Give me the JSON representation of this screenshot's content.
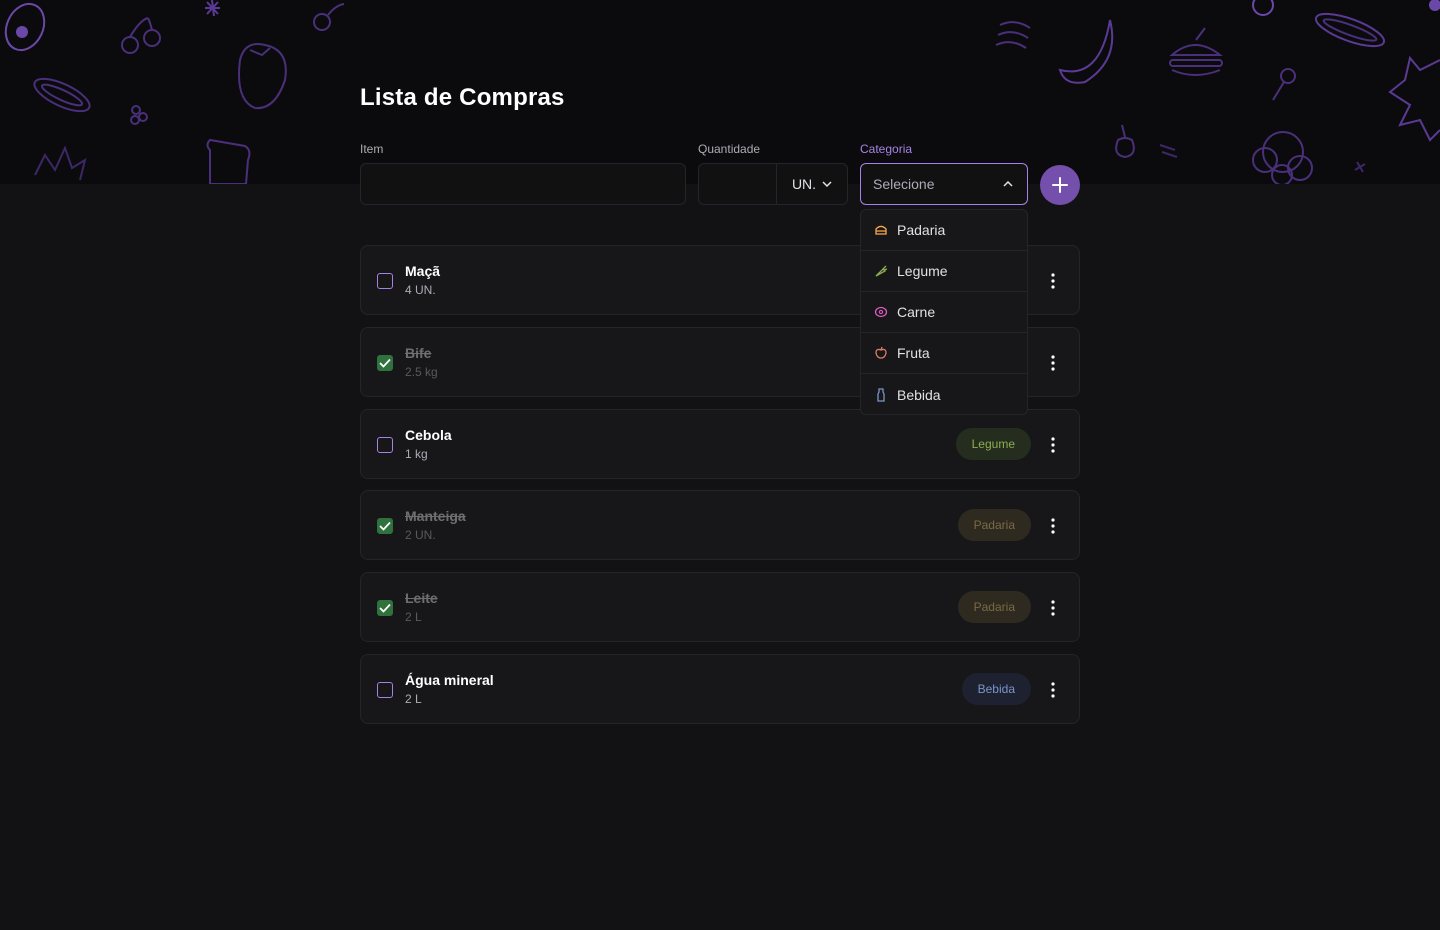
{
  "page": {
    "title": "Lista de Compras"
  },
  "form": {
    "item_label": "Item",
    "item_value": "",
    "quantity_label": "Quantidade",
    "quantity_value": "",
    "unit_value": "UN.",
    "category_label": "Categoria",
    "category_placeholder": "Selecione",
    "add_icon": "plus-icon"
  },
  "dropdown": {
    "open": true,
    "options": [
      {
        "label": "Padaria",
        "icon": "bread-icon",
        "color": "#fba94c"
      },
      {
        "label": "Legume",
        "icon": "carrot-icon",
        "color": "#8cad51"
      },
      {
        "label": "Carne",
        "icon": "beef-icon",
        "color": "#db5bbf"
      },
      {
        "label": "Fruta",
        "icon": "apple-icon",
        "color": "#e07b67"
      },
      {
        "label": "Bebida",
        "icon": "milk-icon",
        "color": "#7b94cb"
      }
    ]
  },
  "items": [
    {
      "name": "Maçã",
      "quantity": "4 UN.",
      "checked": false,
      "category": ""
    },
    {
      "name": "Bife",
      "quantity": "2.5 kg",
      "checked": true,
      "category": ""
    },
    {
      "name": "Cebola",
      "quantity": "1 kg",
      "checked": false,
      "category": "Legume"
    },
    {
      "name": "Manteiga",
      "quantity": "2 UN.",
      "checked": true,
      "category": "Padaria"
    },
    {
      "name": "Leite",
      "quantity": "2 L",
      "checked": true,
      "category": "Padaria"
    },
    {
      "name": "Água mineral",
      "quantity": "2 L",
      "checked": false,
      "category": "Bebida"
    }
  ],
  "colors": {
    "accent": "#a881e6",
    "accent_button": "#7450ac",
    "checked": "#2f723d",
    "tag_legume_bg": "#252d1e",
    "tag_legume_fg": "#8cad51",
    "tag_padaria_bg": "#2e2a20",
    "tag_padaria_fg": "#7a6a44",
    "tag_bebida_bg": "#1e2230",
    "tag_bebida_fg": "#7b94cb"
  }
}
